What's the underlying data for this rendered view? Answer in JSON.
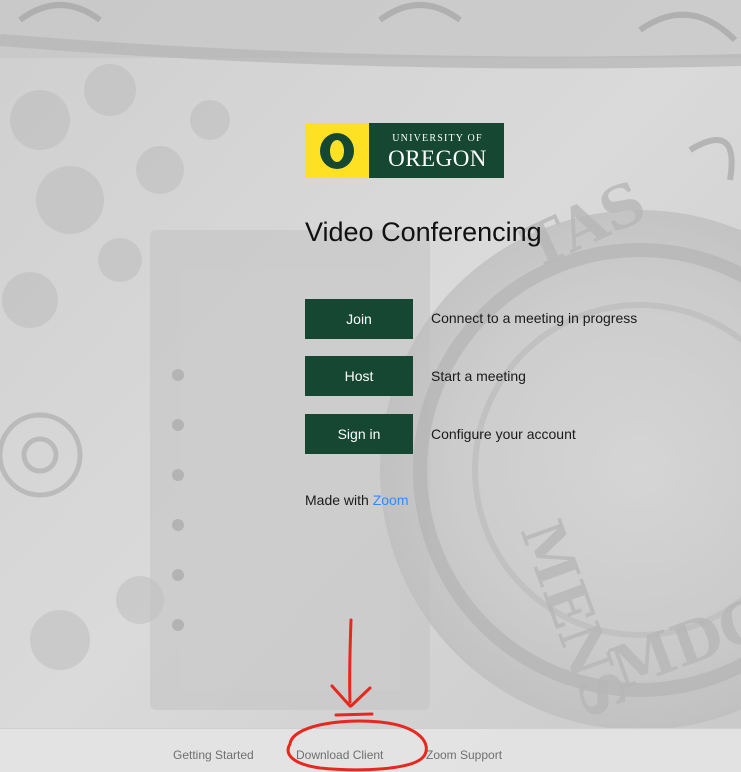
{
  "logo": {
    "mark": "O",
    "line1": "UNIVERSITY OF",
    "line2": "OREGON",
    "colors": {
      "green": "#154733",
      "yellow": "#fee123"
    }
  },
  "main": {
    "title": "Video Conferencing",
    "actions": [
      {
        "label": "Join",
        "description": "Connect to a meeting in progress"
      },
      {
        "label": "Host",
        "description": "Start a meeting"
      },
      {
        "label": "Sign in",
        "description": "Configure your account"
      }
    ],
    "made_with_prefix": "Made with",
    "made_with_link": "Zoom",
    "link_color": "#2d8cff"
  },
  "footer": {
    "links": [
      "Getting Started",
      "Download Client",
      "Zoom Support"
    ]
  },
  "annotation": {
    "type": "red hand-drawn arrow and circle",
    "color": "#e8271f"
  }
}
